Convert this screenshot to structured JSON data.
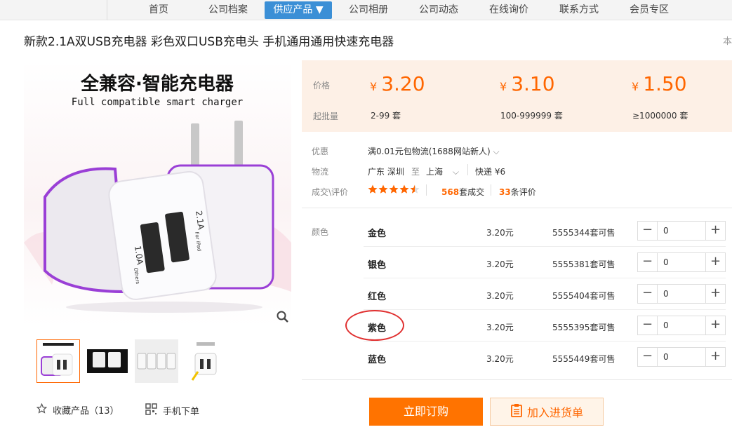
{
  "nav": {
    "items": [
      "首页",
      "公司档案",
      "供应产品 ▼",
      "公司相册",
      "公司动态",
      "在线询价",
      "联系方式",
      "会员专区"
    ]
  },
  "product": {
    "title": "新款2.1A双USB充电器 彩色双口USB充电头 手机通用通用快速充电器",
    "edge_char": "本",
    "image_text_cn": "全兼容·智能充电器",
    "image_text_en": "Full compatible smart charger",
    "charger_label_1": "2.1A",
    "charger_label_2": "For iPad",
    "charger_label_3": "1.0A",
    "charger_label_4": "Others"
  },
  "pricing": {
    "price_label": "价格",
    "moq_label": "起批量",
    "tiers": [
      {
        "price": "3.20",
        "range": "2-99 套"
      },
      {
        "price": "3.10",
        "range": "100-999999 套"
      },
      {
        "price": "1.50",
        "range": "≥1000000 套"
      }
    ],
    "currency": "¥"
  },
  "info": {
    "promo_label": "优惠",
    "promo_value": "满0.01元包物流(1688网站新人)",
    "logistics_label": "物流",
    "from_city": "广东 深圳",
    "to_word": "至",
    "to_city": "上海",
    "shipping": "快递 ¥6",
    "deals_label": "成交\\评价",
    "rating_stars": 4.5,
    "deals_count": "568",
    "deals_text": "套成交",
    "reviews_count": "33",
    "reviews_text": "条评价"
  },
  "variants": {
    "label": "颜色",
    "rows": [
      {
        "name": "金色",
        "price": "3.20元",
        "stock": "5555344套可售",
        "qty": "0"
      },
      {
        "name": "银色",
        "price": "3.20元",
        "stock": "5555381套可售",
        "qty": "0"
      },
      {
        "name": "红色",
        "price": "3.20元",
        "stock": "5555404套可售",
        "qty": "0"
      },
      {
        "name": "紫色",
        "price": "3.20元",
        "stock": "5555395套可售",
        "qty": "0"
      },
      {
        "name": "蓝色",
        "price": "3.20元",
        "stock": "5555449套可售",
        "qty": "0"
      }
    ]
  },
  "actions": {
    "favorite": "收藏产品（13）",
    "mobile_order": "手机下单",
    "buy_now": "立即订购",
    "add_cart": "加入进货单"
  },
  "colors": {
    "accent": "#ff7300",
    "nav_active": "#3b8fd6",
    "price_bg": "#fdf0e6",
    "circle": "#e03030",
    "charger_purple": "#8a2be2"
  }
}
